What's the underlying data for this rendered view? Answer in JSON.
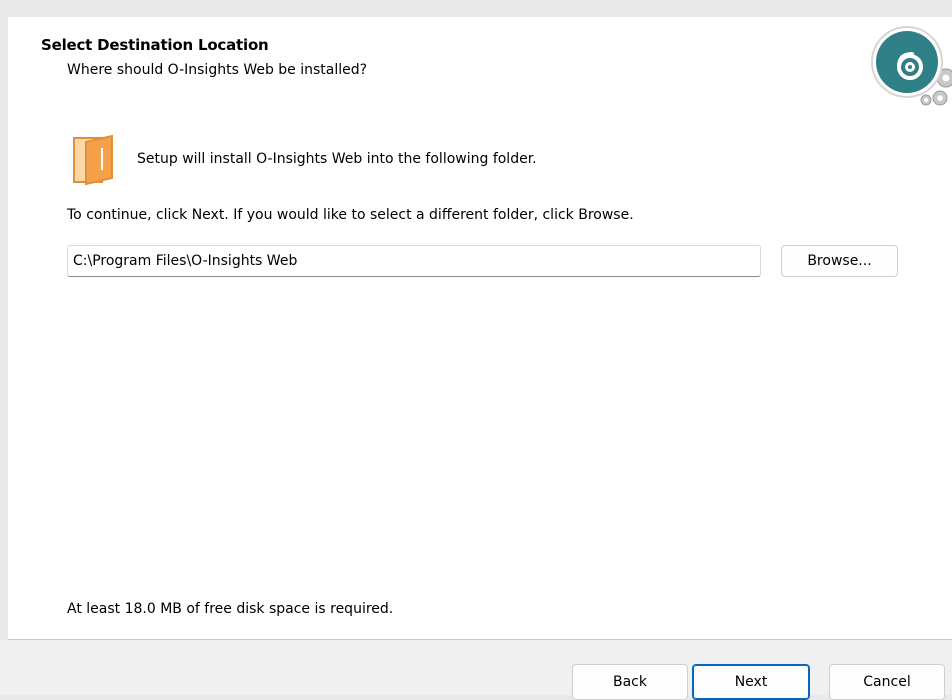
{
  "header": {
    "title": "Select Destination Location",
    "subtitle": "Where should O-Insights Web be installed?"
  },
  "logo": {
    "icon": "o-insights-logo-icon"
  },
  "folder": {
    "icon": "folder-icon",
    "text": "Setup will install O-Insights Web into the following folder."
  },
  "instructions": "To continue, click Next. If you would like to select a different folder, click Browse.",
  "destination": {
    "value": "C:\\Program Files\\O-Insights Web",
    "browse_label": "Browse..."
  },
  "disk_space": "At least 18.0 MB of free disk space is required.",
  "footer": {
    "back_label": "Back",
    "next_label": "Next",
    "cancel_label": "Cancel"
  },
  "colors": {
    "logo_teal": "#2f7f86",
    "folder_orange": "#f4a14a",
    "default_button_border": "#0a64c2"
  }
}
